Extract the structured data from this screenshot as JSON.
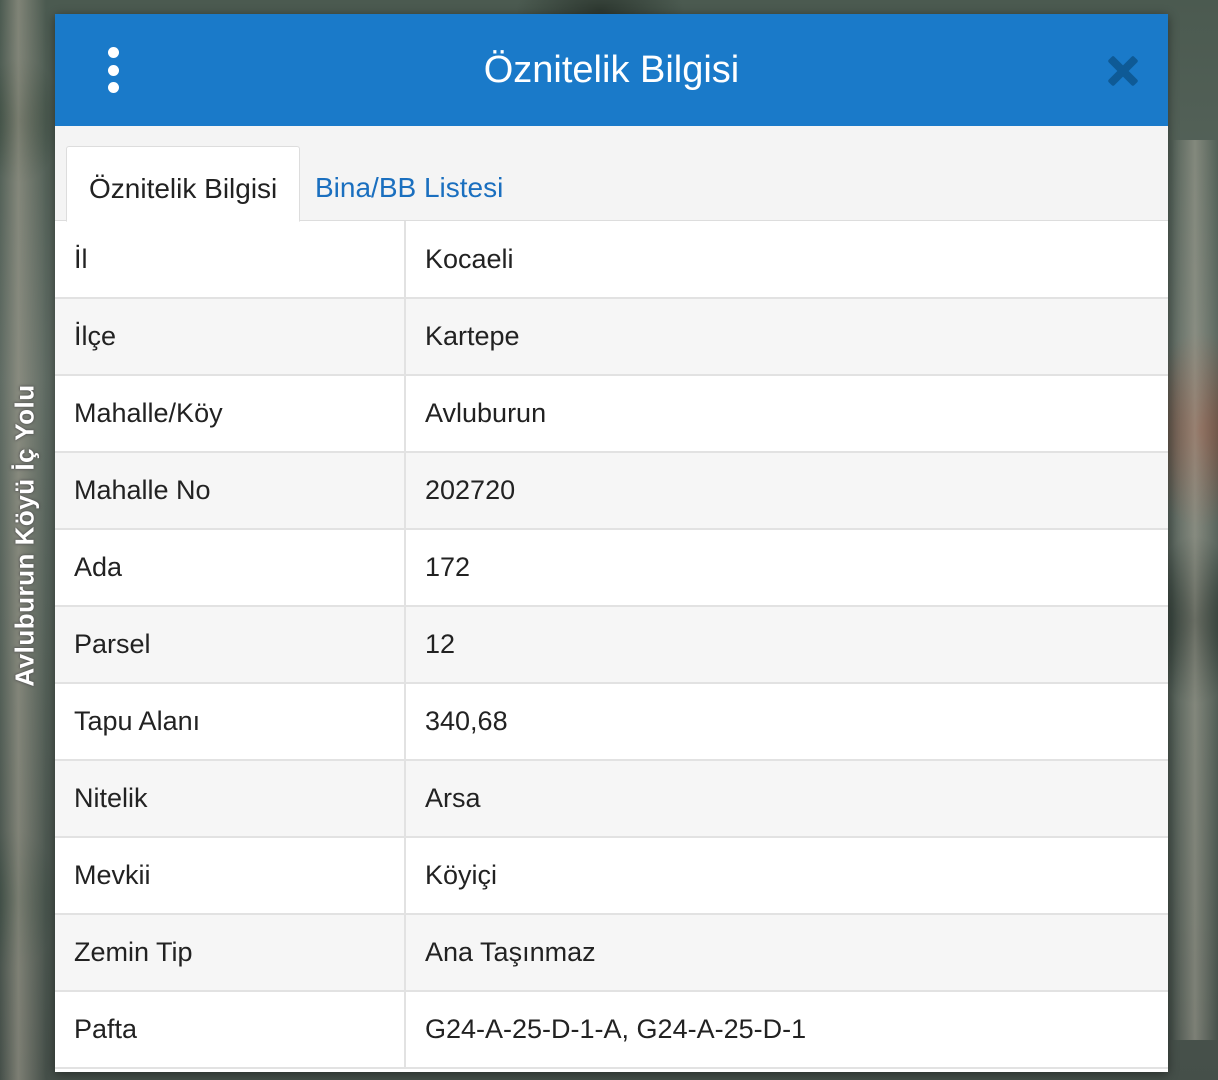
{
  "map": {
    "road_label": "Avluburun Köyü İç Yolu"
  },
  "dialog": {
    "title": "Öznitelik Bilgisi",
    "menu_icon": "kebab-menu-icon",
    "close_icon": "close-icon",
    "header_color": "#1a7ac9",
    "close_color": "#0e5a96"
  },
  "tabs": [
    {
      "label": "Öznitelik Bilgisi",
      "active": true
    },
    {
      "label": "Bina/BB Listesi",
      "active": false
    }
  ],
  "attributes": [
    {
      "label": "İl",
      "value": "Kocaeli"
    },
    {
      "label": "İlçe",
      "value": "Kartepe"
    },
    {
      "label": "Mahalle/Köy",
      "value": "Avluburun"
    },
    {
      "label": "Mahalle No",
      "value": "202720"
    },
    {
      "label": "Ada",
      "value": "172"
    },
    {
      "label": "Parsel",
      "value": "12"
    },
    {
      "label": "Tapu Alanı",
      "value": "340,68"
    },
    {
      "label": "Nitelik",
      "value": "Arsa"
    },
    {
      "label": "Mevkii",
      "value": "Köyiçi"
    },
    {
      "label": "Zemin Tip",
      "value": "Ana Taşınmaz"
    },
    {
      "label": "Pafta",
      "value": "G24-A-25-D-1-A, G24-A-25-D-1"
    }
  ]
}
